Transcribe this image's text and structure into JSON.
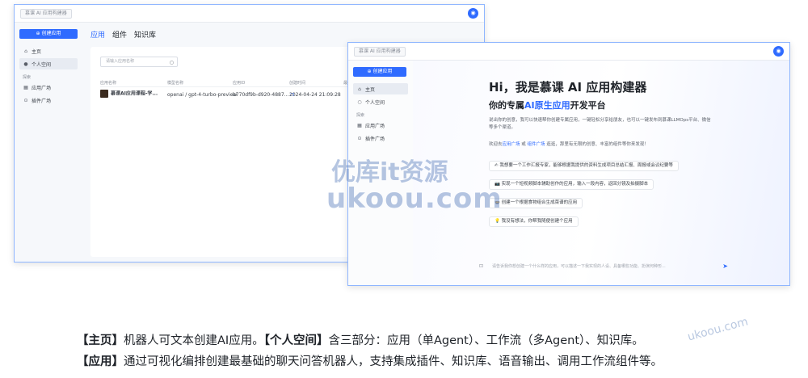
{
  "window1": {
    "breadcrumb": "慕课 AI 应用构建器",
    "sidebar": {
      "create_label": "创建应用",
      "items": [
        {
          "icon": "home-icon",
          "label": "主页"
        },
        {
          "icon": "user-icon",
          "label": "个人空间"
        }
      ],
      "section": "探索",
      "explore": [
        {
          "icon": "grid-icon",
          "label": "应用广场"
        },
        {
          "icon": "plugin-icon",
          "label": "插件广场"
        }
      ]
    },
    "tabs": [
      "应用",
      "组件",
      "知识库"
    ],
    "search_placeholder": "请输入应用名称",
    "table": {
      "headers": [
        "应用名称",
        "模型名称",
        "应用ID",
        "创建时间",
        "最近"
      ],
      "rows": [
        {
          "name": "慕课AI应用课程-学...",
          "model": "openai / gpt-4-turbo-preview",
          "id": "b770df9b-d920-4887...",
          "created": "2024-04-24 21:09:28"
        }
      ]
    }
  },
  "window2": {
    "breadcrumb": "慕课 AI 应用构建器",
    "sidebar": {
      "create_label": "创建应用",
      "items": [
        {
          "icon": "home-icon",
          "label": "主页"
        },
        {
          "icon": "user-icon",
          "label": "个人空间"
        }
      ],
      "section": "探索",
      "explore": [
        {
          "icon": "grid-icon",
          "label": "应用广场"
        },
        {
          "icon": "plugin-icon",
          "label": "插件广场"
        }
      ]
    },
    "hero_title": "Hi，我是慕课 AI 应用构建器",
    "hero_sub_prefix": "你的专属",
    "hero_sub_highlight": "AI原生应用",
    "hero_sub_suffix": "开发平台",
    "description": "说出你的创意，我可以快速帮你创建专属应用，一键轻松分享给朋友，也可以一键发布到慕课LLMOps平台、微信等多个渠道。",
    "welcome_prefix": "欢迎去",
    "welcome_link1": "应用广场",
    "welcome_mid": "或",
    "welcome_link2": "组件广场",
    "welcome_suffix": "逛逛，那里有无限的创意、丰富的组件等你来发现！",
    "suggestions": [
      {
        "icon": "✍",
        "text": "我想要一个工作汇报专家，能够根据我提供的资料生成项目总结汇报、周报或会议纪要等"
      },
      {
        "icon": "📷",
        "text": "实现一个短视频脚本辅助创作的应用，输入一段内容，返回分镜及拍摄脚本"
      },
      {
        "icon": "🍲",
        "text": "创建一个根据食物组合生成菜谱的应用"
      },
      {
        "icon": "💡",
        "text": "我没有想法，你帮我随便创建个应用"
      }
    ],
    "input_placeholder": "请告诉我你想创建一个什么样的应用，可以描述一下我实现的人设、具备哪些功能、扮演何种形..."
  },
  "watermark": {
    "line1": "优库it资源",
    "line2": "ukoou.com",
    "corner": "ukoou.com"
  },
  "caption": {
    "line1_b1": "【主页】",
    "line1_t1": "机器人可文本创建AI应用。",
    "line1_b2": "【个人空间】",
    "line1_t2": "含三部分：应用（单Agent）、工作流（多Agent）、知识库。",
    "line2_b1": "【应用】",
    "line2_t1": "通过可视化编排创建最基础的聊天问答机器人，支持集成插件、知识库、语音输出、调用工作流组件等。"
  }
}
